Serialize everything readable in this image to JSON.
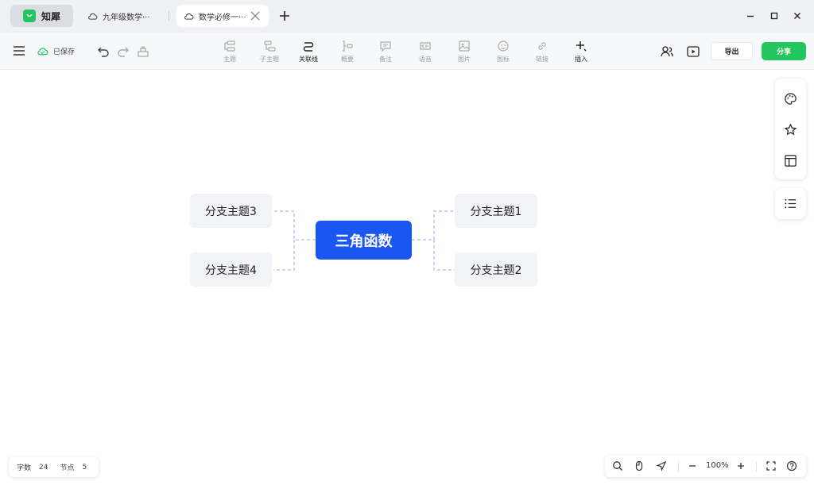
{
  "app": {
    "name": "知犀"
  },
  "tabs": [
    {
      "label": "九年级数学···"
    },
    {
      "label": "数学必修一···"
    }
  ],
  "toolbar": {
    "saved_label": "已保存",
    "tools": [
      {
        "label": "主题",
        "icon": "topic-icon"
      },
      {
        "label": "子主题",
        "icon": "subtopic-icon"
      },
      {
        "label": "关联线",
        "icon": "relation-line-icon"
      },
      {
        "label": "概要",
        "icon": "summary-icon"
      },
      {
        "label": "备注",
        "icon": "note-icon"
      },
      {
        "label": "语音",
        "icon": "voice-icon"
      },
      {
        "label": "图片",
        "icon": "image-icon"
      },
      {
        "label": "图标",
        "icon": "emoji-icon"
      },
      {
        "label": "链接",
        "icon": "link-icon"
      },
      {
        "label": "插入",
        "icon": "insert-icon"
      }
    ],
    "export_label": "导出",
    "share_label": "分享"
  },
  "mindmap": {
    "center": "三角函数",
    "branches": {
      "b1": "分支主题1",
      "b2": "分支主题2",
      "b3": "分支主题3",
      "b4": "分支主题4"
    }
  },
  "stats": {
    "chars_label": "字数",
    "chars_value": "24",
    "nodes_label": "节点",
    "nodes_value": "5"
  },
  "zoom": {
    "value": "100%"
  },
  "colors": {
    "accent": "#22c55e",
    "center_node": "#1a56f0",
    "node_bg": "#f2f3f6"
  }
}
